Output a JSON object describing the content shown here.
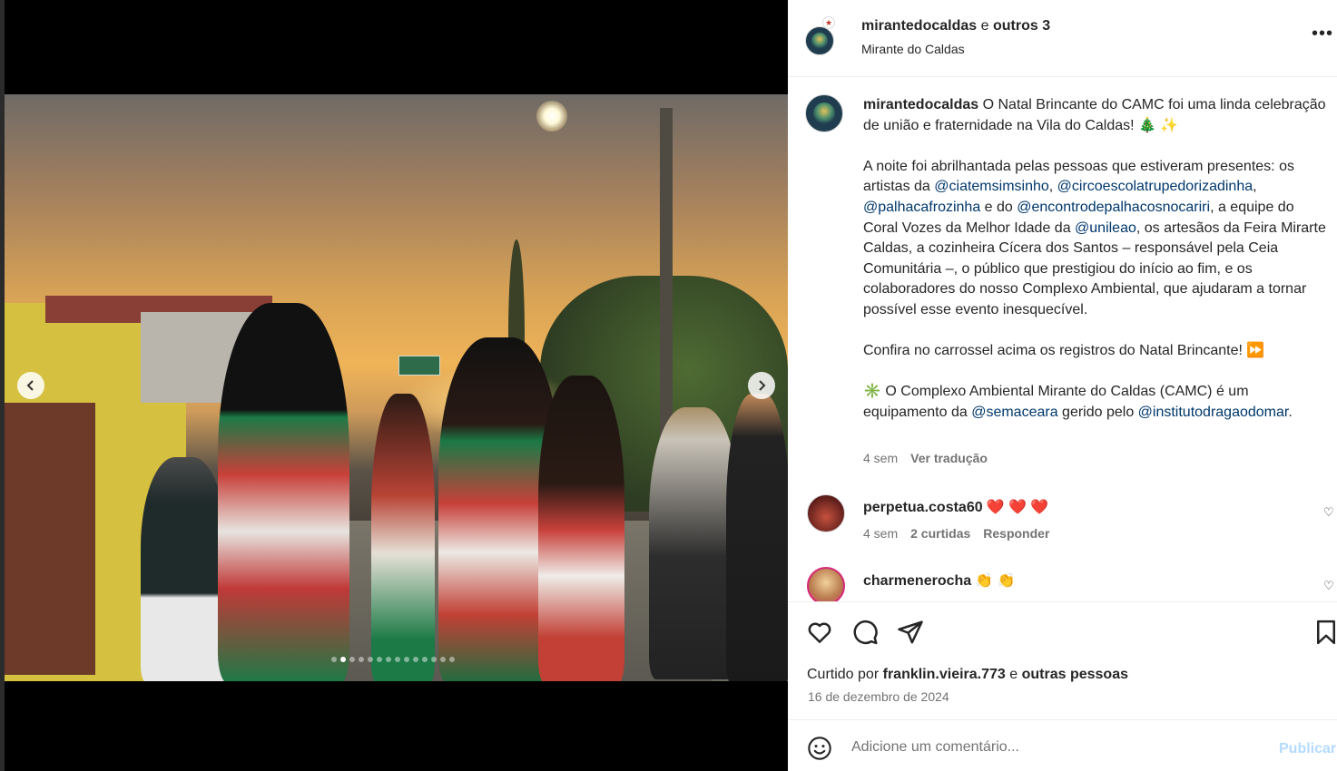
{
  "post": {
    "author": "mirantedocaldas",
    "collab_connector": "e",
    "collab_others": "outros 3",
    "location": "Mirante do Caldas",
    "more_label": "•••",
    "carousel": {
      "total_slides": 14,
      "active_index": 1
    }
  },
  "caption": {
    "user": "mirantedocaldas",
    "p1": " O Natal Brincante do CAMC foi uma linda celebração de união e fraternidade na Vila do Caldas! 🎄 ✨",
    "p2a": "A noite foi abrilhantada pelas pessoas que estiveram presentes: os artistas da ",
    "m1": "@ciatemsimsinho",
    "s1": ", ",
    "m2": "@circoescolatrupedorizadinha",
    "s2": ", ",
    "m3": "@palhacafrozinha",
    "s3": " e do ",
    "m4": "@encontrodepalhacosnocariri",
    "s4": ", a equipe do Coral Vozes da Melhor Idade da ",
    "m5": "@unileao",
    "p2b": ", os artesãos da Feira Mirarte Caldas, a cozinheira Cícera dos Santos – responsável pela Ceia Comunitária –, o público que prestigiou do início ao fim, e os colaboradores do nosso Complexo Ambiental, que ajudaram a tornar possível esse evento inesquecível.",
    "p3": "Confira no carrossel acima os registros do Natal Brincante! ⏩",
    "p4a": "✳️ O Complexo Ambiental Mirante do Caldas (CAMC) é um equipamento da ",
    "m6": "@semaceara",
    "p4b": " gerido pelo ",
    "m7": "@institutodragaodomar",
    "p4c": ".",
    "time": "4 sem",
    "translate": "Ver tradução"
  },
  "comments": [
    {
      "user": "perpetua.costa60",
      "text": "❤️ ❤️ ❤️",
      "time": "4 sem",
      "likes": "2 curtidas",
      "reply": "Responder"
    },
    {
      "user": "charmenerocha",
      "text": "👏 👏"
    }
  ],
  "likes": {
    "prefix": "Curtido por",
    "user": "franklin.vieira.773",
    "connector": "e",
    "others": "outras pessoas"
  },
  "date": "16 de dezembro de 2024",
  "comment_box": {
    "placeholder": "Adicione um comentário...",
    "post_label": "Publicar"
  },
  "colors": {
    "link": "#00376b",
    "secondary_text": "#737373",
    "post_button_disabled": "#b3dbff"
  }
}
